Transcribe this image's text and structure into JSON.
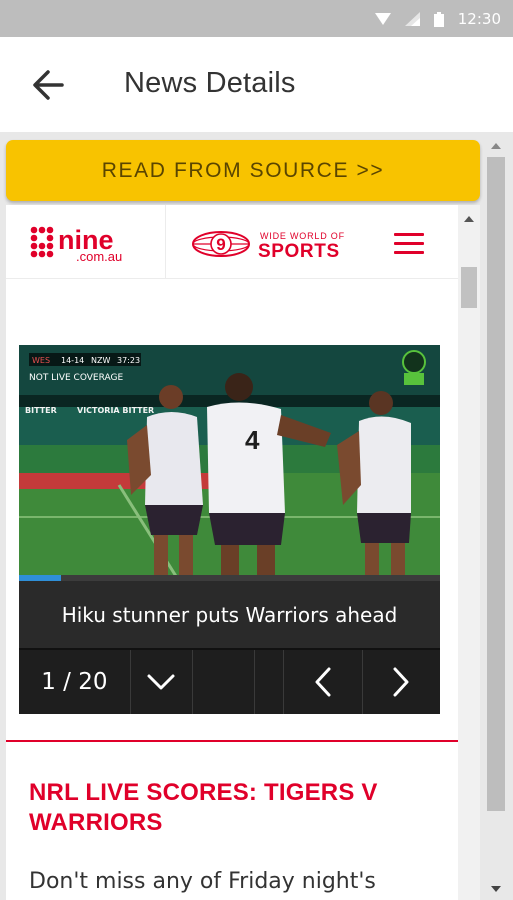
{
  "status_bar": {
    "time": "12:30"
  },
  "app_bar": {
    "title": "News Details"
  },
  "read_source": {
    "label": "READ FROM SOURCE >>"
  },
  "site_header": {
    "nine_logo": {
      "brand": "nine",
      "domain": ".com.au"
    },
    "wws_logo": {
      "mark": "9",
      "line1": "WIDE WORLD OF",
      "line2": "SPORTS"
    }
  },
  "video": {
    "overlay": {
      "live_tag": "NOT LIVE COVERAGE",
      "score": "14-14",
      "team_a": "WES",
      "team_b": "NZW",
      "clock": "37:23",
      "banner_1": "BITTER",
      "banner_2": "VICTORIA BITTER"
    },
    "caption": "Hiku stunner puts Warriors ahead",
    "counter": "1 / 20",
    "progress": 0.1
  },
  "article": {
    "headline": "NRL LIVE SCORES: TIGERS V WARRIORS",
    "body": "Don't miss any of Friday night's"
  },
  "colors": {
    "accent_yellow": "#f8c300",
    "brand_red": "#e0002a",
    "status_bar": "#bdbdbd"
  }
}
